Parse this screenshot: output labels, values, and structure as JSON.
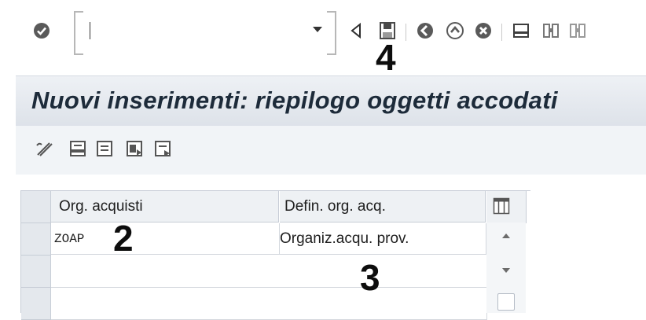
{
  "toolbar": {
    "command_field": {
      "value": "",
      "placeholder": ""
    },
    "icons": [
      "enter-icon",
      "back-arrow-icon",
      "save-icon",
      "back-icon",
      "exit-icon",
      "cancel-icon",
      "print-icon",
      "find-icon",
      "find-next-icon"
    ]
  },
  "annotations": {
    "n2": "2",
    "n3": "3",
    "n4": "4"
  },
  "screen": {
    "title": "Nuovi inserimenti: riepilogo oggetti accodati"
  },
  "app_toolbar": {
    "icons": [
      "change-icon",
      "save-local-icon",
      "select-all-icon",
      "select-block-icon",
      "deselect-all-icon"
    ]
  },
  "table": {
    "columns": [
      "Org. acquisti",
      "Defin. org. acq."
    ],
    "rows": [
      [
        "ZOAP",
        "Organiz.acqu. prov."
      ],
      [
        "",
        ""
      ],
      [
        "",
        ""
      ]
    ]
  },
  "colors": {
    "title_bg": "#dde2e9",
    "title_text": "#1d2b3a",
    "header_bg": "#eef1f4"
  }
}
